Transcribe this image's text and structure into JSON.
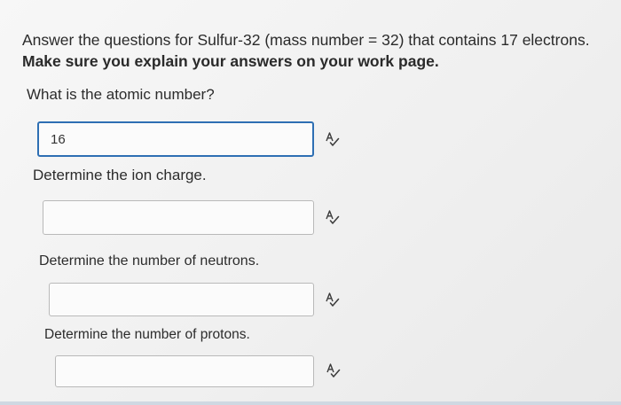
{
  "intro": {
    "line1": "Answer the questions for Sulfur-32 (mass number = 32) that contains 17 electrons.",
    "line2": "Make sure you explain your answers on your work page."
  },
  "questions": [
    {
      "prompt": "What is the atomic number?",
      "answer": "16",
      "placeholder": ""
    },
    {
      "prompt": "Determine the ion charge.",
      "answer": "",
      "placeholder": ""
    },
    {
      "prompt": "Determine the number of neutrons.",
      "answer": "",
      "placeholder": ""
    },
    {
      "prompt": "Determine the number of protons.",
      "answer": "",
      "placeholder": ""
    }
  ],
  "icons": {
    "spellcheck": "spellcheck-icon"
  },
  "colors": {
    "active_border": "#2e6fb3",
    "text": "#2b2b2b",
    "input_border": "#b9b9b9"
  }
}
